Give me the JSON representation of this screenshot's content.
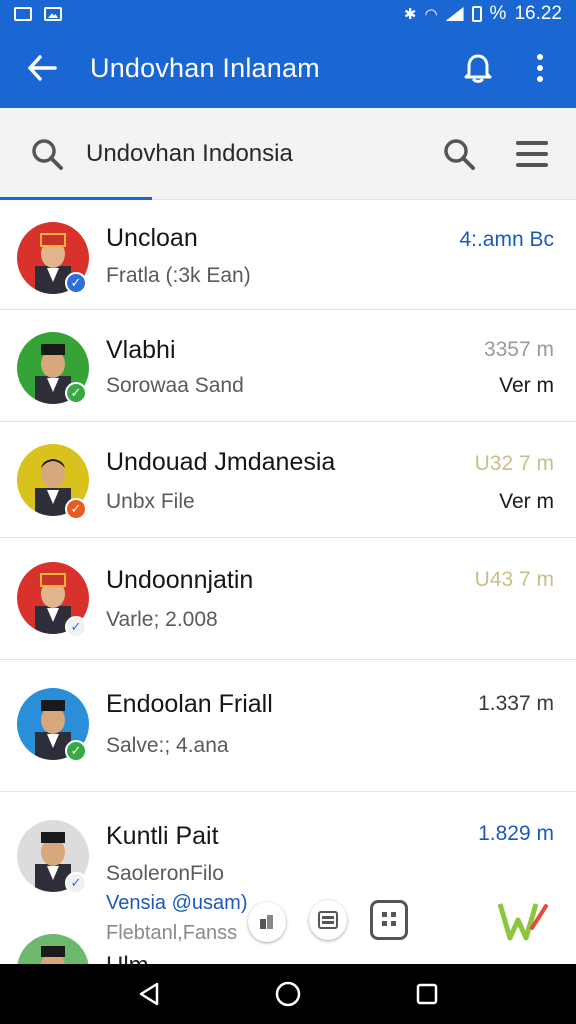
{
  "status_bar": {
    "battery": "%",
    "time": "16.22"
  },
  "app_bar": {
    "title": "Undovhan Inlanam"
  },
  "search": {
    "value": "Undovhan Indonsia"
  },
  "colors": {
    "primary": "#1a66d2",
    "verified_blue": "#2f6fd6",
    "verified_green": "#3aa845",
    "verified_orange": "#ea5a21",
    "meta_blue": "#1a5ab8",
    "meta_gold": "#b8ad73"
  },
  "contacts": [
    {
      "name": "Uncloan",
      "subtitle": "Fratla (:3k Ean)",
      "meta": "4:.amn Bc",
      "meta_color": "#1a5ab8",
      "avatar_bg": "#d9322c",
      "hat": "red",
      "badge": "blue"
    },
    {
      "name": "Vlabhi",
      "subtitle": "Sorowaa Sand",
      "meta": "3357 m",
      "meta_secondary": "Ver m",
      "meta_color": "#9a9a9a",
      "avatar_bg": "#36a337",
      "hat": "black",
      "badge": "green"
    },
    {
      "name": "Undouad Jmdanesia",
      "subtitle": "Unbx File",
      "meta": "U32 7 m",
      "meta_secondary": "Ver m",
      "meta_color": "#c8c08a",
      "avatar_bg": "#d9c11e",
      "hat": "none",
      "badge": "orange"
    },
    {
      "name": "Undoonnjatin",
      "subtitle": "Varle; 2.008",
      "meta": "U43 7 m",
      "meta_color": "#c8c08a",
      "avatar_bg": "#d9322c",
      "hat": "red",
      "badge": "white"
    },
    {
      "name": "Endoolan Friall",
      "subtitle": "Salve:; 4.ana",
      "meta": "1.337 m",
      "meta_color": "#3a3a3a",
      "avatar_bg": "#2a8fd8",
      "hat": "black",
      "badge": "green"
    },
    {
      "name": "Kuntli Pait",
      "subtitle": "SaoleronFilo",
      "meta": "1.829 m",
      "meta_color": "#1a5ab8",
      "avatar_bg": "#dcdcdc",
      "hat": "black",
      "badge": "white",
      "extra_line_1": "Vensia @usam)",
      "extra_line_2": "Flebtanl,Fanss"
    }
  ],
  "partial_next_name": "Ulm",
  "icons": {
    "back": "arrow-left-icon",
    "bell": "bell-icon",
    "more": "more-vert-icon",
    "search": "search-icon",
    "menu": "hamburger-menu-icon",
    "nav_back": "triangle-back-icon",
    "nav_home": "circle-home-icon",
    "nav_recents": "square-recents-icon"
  }
}
